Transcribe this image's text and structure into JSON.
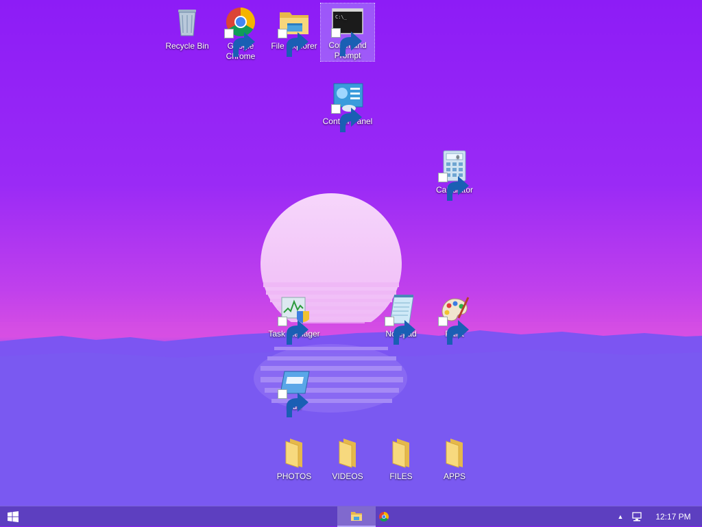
{
  "desktop": {
    "icons": [
      {
        "id": "recycle-bin",
        "label": "Recycle Bin"
      },
      {
        "id": "google-chrome",
        "label": "Google Chrome"
      },
      {
        "id": "file-explorer",
        "label": "File Explorer"
      },
      {
        "id": "command-prompt",
        "label": "Command Prompt"
      },
      {
        "id": "control-panel",
        "label": "Control Panel"
      },
      {
        "id": "calculator",
        "label": "Calculator"
      },
      {
        "id": "task-manager",
        "label": "Task Manager"
      },
      {
        "id": "notepad",
        "label": "Notepad"
      },
      {
        "id": "paint",
        "label": "Paint"
      },
      {
        "id": "run",
        "label": "Run"
      },
      {
        "id": "photos",
        "label": "PHOTOS"
      },
      {
        "id": "videos",
        "label": "VIDEOS"
      },
      {
        "id": "files",
        "label": "FILES"
      },
      {
        "id": "apps",
        "label": "APPS"
      }
    ],
    "selected": "Command Prompt"
  },
  "cmd_icon_text": "C:\\_",
  "calculator_display": "0",
  "taskbar": {
    "pinned": [
      "file-explorer-icon",
      "chrome-icon"
    ],
    "tray_chevron": "▲",
    "clock": "12:17 PM"
  },
  "colors": {
    "sky_top": "#8d1cf6",
    "horizon": "#d84fe2",
    "sun": "#f4c8f8",
    "mountains": "#7e55f2",
    "taskbar": "#5d3fc0"
  }
}
